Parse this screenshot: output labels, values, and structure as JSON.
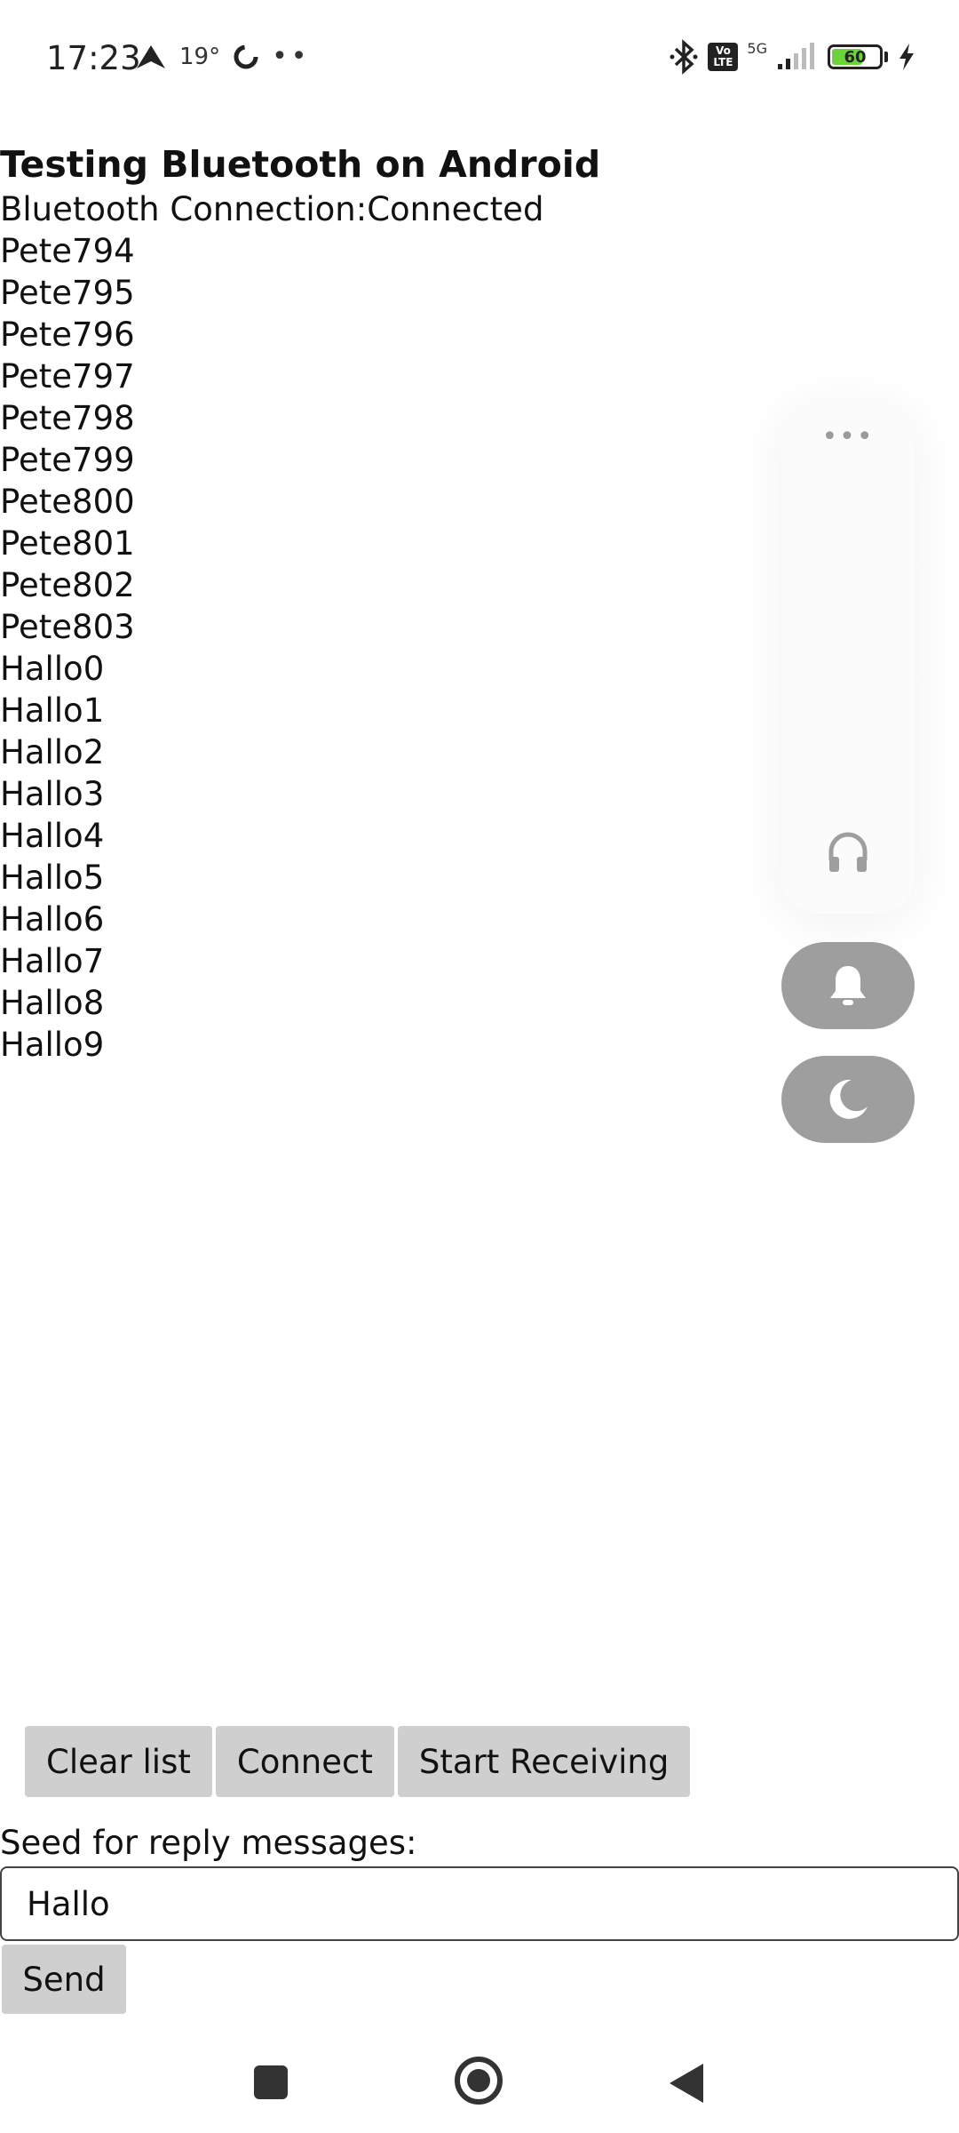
{
  "status_bar": {
    "time": "17:23",
    "temperature": "19°",
    "dots": "••",
    "volte_label": "Vo LTE",
    "network": "5G",
    "battery_level": "60"
  },
  "header": {
    "title": "Testing Bluetooth on Android",
    "connection_text": "Bluetooth Connection:Connected"
  },
  "messages": [
    "Pete794",
    "Pete795",
    "Pete796",
    "Pete797",
    "Pete798",
    "Pete799",
    "Pete800",
    "Pete801",
    "Pete802",
    "Pete803",
    "Hallo0",
    "Hallo1",
    "Hallo2",
    "Hallo3",
    "Hallo4",
    "Hallo5",
    "Hallo6",
    "Hallo7",
    "Hallo8",
    "Hallo9"
  ],
  "side_panel": {
    "menu_dots": "•••",
    "icons": [
      "headphones-icon",
      "bell-icon",
      "moon-icon"
    ]
  },
  "actions": {
    "clear_label": "Clear list",
    "connect_label": "Connect",
    "start_label": "Start Receiving"
  },
  "seed": {
    "label": "Seed for reply messages:",
    "value": "Hallo"
  },
  "send": {
    "label": "Send"
  },
  "nav": {
    "icons": [
      "recent-apps-icon",
      "home-icon",
      "back-icon"
    ]
  },
  "colors": {
    "button_bg": "#cfcfcf",
    "round_button_bg": "#9e9e9e",
    "battery_fill": "#6cd33b"
  }
}
